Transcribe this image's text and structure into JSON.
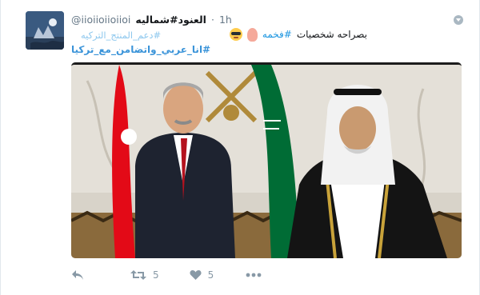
{
  "tweet": {
    "handle": "@iioiioiioiioi",
    "display_name": "العنود#شماليه",
    "separator": "·",
    "timestamp": "1h",
    "text_plain": "بصراحه شخصيات",
    "text_hashtag": "#فخمه",
    "hashtags": [
      "#دعم_المنتج_التركيه",
      "#انا_عربي_واتضامن_مع_تركيا"
    ],
    "emojis": [
      "thumbs-down-emoji",
      "sunglasses-emoji"
    ]
  },
  "media": {
    "description_icon": "photo",
    "flag_colors": {
      "turkey": "#e30a17",
      "saudi": "#006c35"
    }
  },
  "actions": {
    "reply_icon": "reply-icon",
    "retweet_count": "5",
    "like_count": "5",
    "more_icon": "more-icon"
  },
  "colors": {
    "link": "#1b95e0",
    "meta": "#657786",
    "action": "#8899a6"
  }
}
